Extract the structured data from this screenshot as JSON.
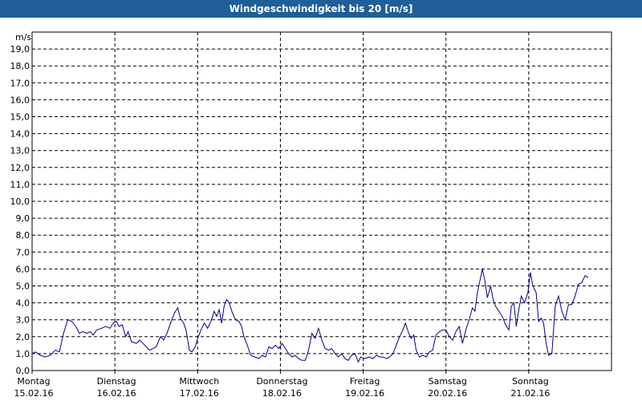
{
  "window": {
    "title": "Windgeschwindigkeit bis 20 [m/s]"
  },
  "chart_data": {
    "type": "line",
    "title": "Windgeschwindigkeit bis 20 [m/s]",
    "ylabel": "m/s",
    "xlabel": "",
    "ylim": [
      0,
      20
    ],
    "xlim": [
      0,
      7
    ],
    "grid": true,
    "line_color": "#000080",
    "y_ticks": [
      "0,0",
      "1,0",
      "2,0",
      "3,0",
      "4,0",
      "5,0",
      "6,0",
      "7,0",
      "8,0",
      "9,0",
      "10,0",
      "11,0",
      "12,0",
      "13,0",
      "14,0",
      "15,0",
      "16,0",
      "17,0",
      "18,0",
      "19,0"
    ],
    "day_labels": [
      {
        "day": "Montag",
        "date": "15.02.16"
      },
      {
        "day": "Dienstag",
        "date": "16.02.16"
      },
      {
        "day": "Mittwoch",
        "date": "17.02.16"
      },
      {
        "day": "Donnerstag",
        "date": "18.02.16"
      },
      {
        "day": "Freitag",
        "date": "19.02.16"
      },
      {
        "day": "Samstag",
        "date": "20.02.16"
      },
      {
        "day": "Sonntag",
        "date": "21.02.16"
      }
    ],
    "series": [
      {
        "points": [
          [
            0.0,
            1.0
          ],
          [
            0.04,
            1.1
          ],
          [
            0.1,
            0.9
          ],
          [
            0.16,
            0.8
          ],
          [
            0.22,
            0.9
          ],
          [
            0.28,
            1.2
          ],
          [
            0.33,
            1.1
          ],
          [
            0.38,
            2.2
          ],
          [
            0.43,
            3.0
          ],
          [
            0.48,
            2.9
          ],
          [
            0.53,
            2.6
          ],
          [
            0.57,
            2.2
          ],
          [
            0.61,
            2.3
          ],
          [
            0.66,
            2.2
          ],
          [
            0.7,
            2.3
          ],
          [
            0.74,
            2.1
          ],
          [
            0.78,
            2.4
          ],
          [
            0.84,
            2.5
          ],
          [
            0.89,
            2.6
          ],
          [
            0.94,
            2.5
          ],
          [
            0.98,
            2.8
          ],
          [
            1.02,
            2.9
          ],
          [
            1.05,
            2.6
          ],
          [
            1.09,
            2.7
          ],
          [
            1.13,
            2.0
          ],
          [
            1.16,
            2.3
          ],
          [
            1.2,
            1.7
          ],
          [
            1.26,
            1.6
          ],
          [
            1.3,
            1.8
          ],
          [
            1.34,
            1.6
          ],
          [
            1.38,
            1.4
          ],
          [
            1.42,
            1.2
          ],
          [
            1.46,
            1.3
          ],
          [
            1.5,
            1.4
          ],
          [
            1.55,
            2.0
          ],
          [
            1.59,
            1.8
          ],
          [
            1.63,
            2.2
          ],
          [
            1.68,
            2.9
          ],
          [
            1.72,
            3.4
          ],
          [
            1.76,
            3.7
          ],
          [
            1.79,
            3.1
          ],
          [
            1.83,
            2.8
          ],
          [
            1.86,
            2.4
          ],
          [
            1.9,
            1.2
          ],
          [
            1.93,
            1.1
          ],
          [
            1.97,
            1.4
          ],
          [
            2.0,
            1.9
          ],
          [
            2.04,
            2.4
          ],
          [
            2.08,
            2.8
          ],
          [
            2.12,
            2.5
          ],
          [
            2.16,
            2.9
          ],
          [
            2.2,
            3.5
          ],
          [
            2.23,
            3.2
          ],
          [
            2.26,
            3.6
          ],
          [
            2.29,
            2.8
          ],
          [
            2.32,
            3.8
          ],
          [
            2.35,
            4.2
          ],
          [
            2.38,
            4.0
          ],
          [
            2.42,
            3.4
          ],
          [
            2.46,
            3.0
          ],
          [
            2.5,
            2.9
          ],
          [
            2.53,
            2.6
          ],
          [
            2.56,
            2.0
          ],
          [
            2.6,
            1.5
          ],
          [
            2.64,
            0.9
          ],
          [
            2.69,
            0.8
          ],
          [
            2.74,
            0.7
          ],
          [
            2.78,
            0.9
          ],
          [
            2.82,
            0.8
          ],
          [
            2.86,
            1.4
          ],
          [
            2.9,
            1.3
          ],
          [
            2.94,
            1.5
          ],
          [
            2.98,
            1.3
          ],
          [
            3.02,
            1.6
          ],
          [
            3.06,
            1.3
          ],
          [
            3.1,
            1.0
          ],
          [
            3.14,
            0.8
          ],
          [
            3.18,
            0.9
          ],
          [
            3.22,
            0.7
          ],
          [
            3.26,
            0.6
          ],
          [
            3.3,
            0.6
          ],
          [
            3.34,
            1.2
          ],
          [
            3.38,
            2.2
          ],
          [
            3.42,
            1.9
          ],
          [
            3.46,
            2.5
          ],
          [
            3.5,
            1.8
          ],
          [
            3.54,
            1.3
          ],
          [
            3.58,
            1.2
          ],
          [
            3.62,
            1.3
          ],
          [
            3.66,
            1.0
          ],
          [
            3.7,
            0.8
          ],
          [
            3.74,
            1.0
          ],
          [
            3.78,
            0.7
          ],
          [
            3.82,
            0.6
          ],
          [
            3.86,
            0.9
          ],
          [
            3.9,
            1.0
          ],
          [
            3.94,
            0.5
          ],
          [
            3.97,
            0.8
          ],
          [
            4.02,
            0.7
          ],
          [
            4.07,
            0.8
          ],
          [
            4.12,
            0.7
          ],
          [
            4.16,
            0.9
          ],
          [
            4.2,
            0.8
          ],
          [
            4.24,
            0.8
          ],
          [
            4.28,
            0.7
          ],
          [
            4.32,
            0.8
          ],
          [
            4.36,
            1.0
          ],
          [
            4.4,
            1.5
          ],
          [
            4.44,
            2.0
          ],
          [
            4.48,
            2.4
          ],
          [
            4.51,
            2.8
          ],
          [
            4.55,
            2.2
          ],
          [
            4.58,
            1.9
          ],
          [
            4.61,
            2.1
          ],
          [
            4.64,
            1.2
          ],
          [
            4.68,
            0.8
          ],
          [
            4.72,
            0.9
          ],
          [
            4.76,
            0.8
          ],
          [
            4.8,
            1.1
          ],
          [
            4.84,
            1.2
          ],
          [
            4.88,
            2.1
          ],
          [
            4.92,
            2.3
          ],
          [
            4.96,
            2.4
          ],
          [
            5.0,
            2.4
          ],
          [
            5.04,
            2.0
          ],
          [
            5.08,
            1.8
          ],
          [
            5.12,
            2.3
          ],
          [
            5.16,
            2.6
          ],
          [
            5.2,
            1.6
          ],
          [
            5.24,
            2.4
          ],
          [
            5.28,
            3.0
          ],
          [
            5.32,
            3.7
          ],
          [
            5.35,
            3.5
          ],
          [
            5.38,
            4.6
          ],
          [
            5.41,
            5.3
          ],
          [
            5.44,
            6.0
          ],
          [
            5.47,
            5.3
          ],
          [
            5.5,
            4.3
          ],
          [
            5.54,
            5.0
          ],
          [
            5.57,
            4.2
          ],
          [
            5.6,
            3.8
          ],
          [
            5.64,
            3.5
          ],
          [
            5.68,
            3.2
          ],
          [
            5.72,
            2.7
          ],
          [
            5.76,
            2.4
          ],
          [
            5.79,
            3.8
          ],
          [
            5.82,
            4.0
          ],
          [
            5.85,
            2.6
          ],
          [
            5.88,
            3.6
          ],
          [
            5.91,
            4.4
          ],
          [
            5.95,
            4.0
          ],
          [
            5.99,
            4.6
          ],
          [
            6.02,
            5.8
          ],
          [
            6.05,
            5.0
          ],
          [
            6.09,
            4.6
          ],
          [
            6.12,
            2.9
          ],
          [
            6.15,
            3.1
          ],
          [
            6.18,
            2.8
          ],
          [
            6.21,
            1.6
          ],
          [
            6.24,
            0.9
          ],
          [
            6.28,
            1.0
          ],
          [
            6.32,
            3.8
          ],
          [
            6.36,
            4.4
          ],
          [
            6.4,
            3.5
          ],
          [
            6.44,
            3.0
          ],
          [
            6.48,
            3.9
          ],
          [
            6.52,
            3.9
          ],
          [
            6.56,
            4.4
          ],
          [
            6.6,
            5.1
          ],
          [
            6.64,
            5.2
          ],
          [
            6.68,
            5.6
          ],
          [
            6.72,
            5.5
          ]
        ]
      }
    ]
  }
}
